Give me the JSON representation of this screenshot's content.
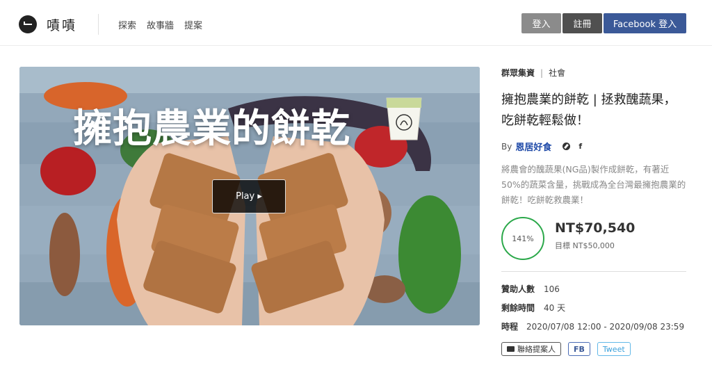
{
  "header": {
    "logo_text": "嘖嘖",
    "nav": [
      "探索",
      "故事牆",
      "提案"
    ],
    "login_label": "登入",
    "register_label": "註冊",
    "facebook_login_label": "Facebook 登入"
  },
  "hero": {
    "title": "擁抱農業的餅乾",
    "play_label": "Play ▸"
  },
  "project": {
    "category": "群眾集資",
    "separator": "|",
    "subcategory": "社會",
    "title": "擁抱農業的餅乾 | 拯救醜蔬果，吃餅乾輕鬆做！",
    "by_label": "By",
    "author": "恩居好食",
    "description": "將農會的醜蔬果(NG品)製作成餅乾，有著近50%的蔬菜含量，挑戰成為全台灣最擁抱農業的餅乾！吃餅乾救農業！",
    "percent_label": "141%",
    "percent_value": 1.41,
    "amount": "NT$70,540",
    "goal": "目標 NT$50,000",
    "stats": {
      "backers_label": "贊助人數",
      "backers_value": "106",
      "remaining_label": "剩餘時間",
      "remaining_value": "40 天",
      "period_label": "時程",
      "period_value": "2020/07/08 12:00 - 2020/09/08 23:59"
    },
    "actions": {
      "contact_label": "聯絡提案人",
      "fb_label": "FB",
      "tweet_label": "Tweet"
    },
    "icons": [
      "compass-icon",
      "facebook-icon"
    ],
    "accent_color": "#2ba84a",
    "link_color": "#1f4aa8",
    "facebook_color": "#3b5998"
  }
}
